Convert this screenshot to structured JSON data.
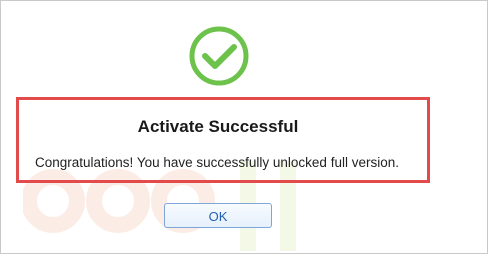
{
  "dialog": {
    "title": "Activate Successful",
    "message": "Congratulations! You have successfully unlocked full version.",
    "ok_label": "OK"
  },
  "icons": {
    "status": "checkmark-circle-icon",
    "watermark": "logo-watermark"
  },
  "colors": {
    "success_green": "#6cc24a",
    "highlight_red": "#e14b4b",
    "button_border": "#7fa6d8",
    "button_text": "#1f5fb4"
  }
}
